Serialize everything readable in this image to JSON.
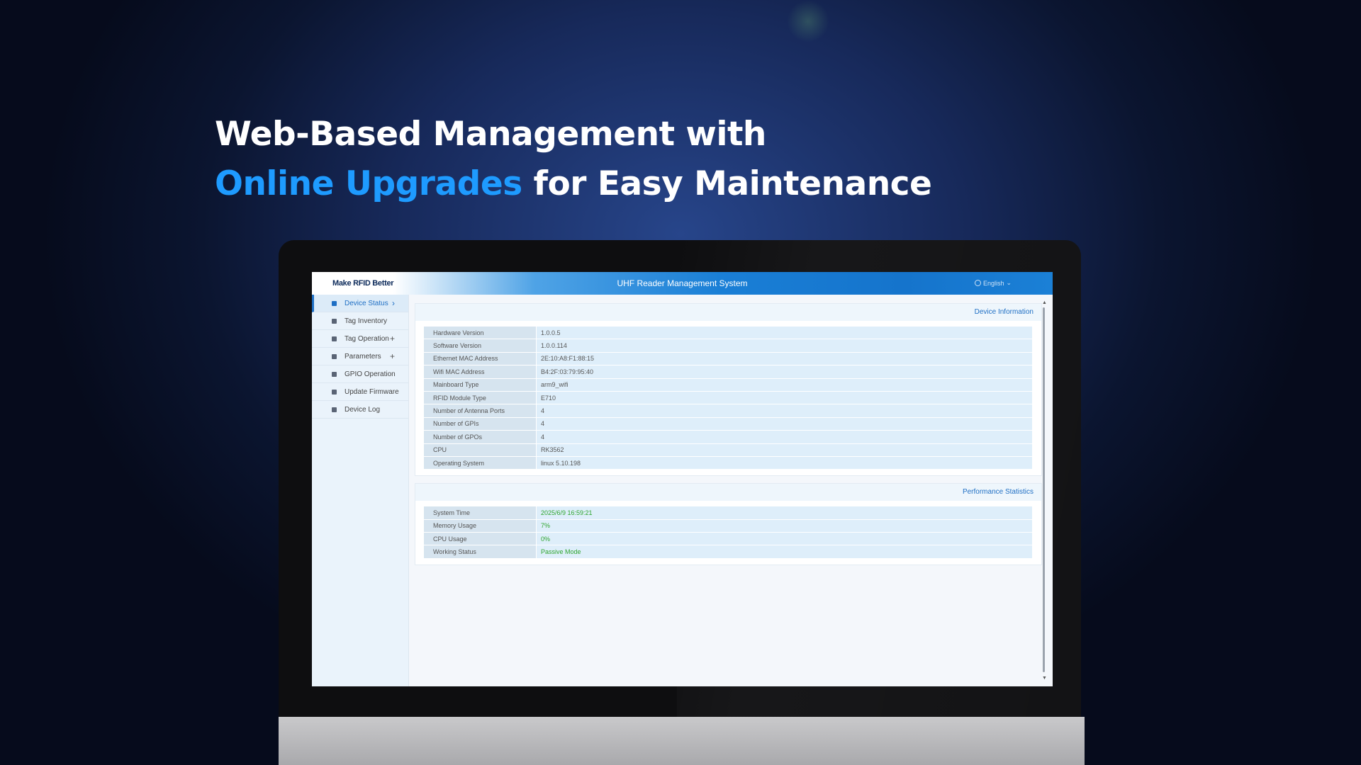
{
  "headline": {
    "line1": "Web-Based Management with",
    "line2_accent": "Online Upgrades",
    "line2_rest": " for Easy Maintenance",
    "accent_color": "#1e9bff"
  },
  "app": {
    "logo": "Make RFID Better",
    "title": "UHF Reader Management System",
    "language": "English",
    "language_icon": "globe-icon"
  },
  "sidebar": {
    "items": [
      {
        "label": "Device Status",
        "icon": "device-status-icon",
        "trail": "›",
        "active": true
      },
      {
        "label": "Tag Inventory",
        "icon": "inventory-icon",
        "trail": "",
        "active": false
      },
      {
        "label": "Tag Operation",
        "icon": "tag-operation-icon",
        "trail": "+",
        "active": false
      },
      {
        "label": "Parameters",
        "icon": "gear-icon",
        "trail": "+",
        "active": false
      },
      {
        "label": "GPIO Operation",
        "icon": "gpio-icon",
        "trail": "",
        "active": false
      },
      {
        "label": "Update Firmware",
        "icon": "firmware-icon",
        "trail": "",
        "active": false
      },
      {
        "label": "Device Log",
        "icon": "log-icon",
        "trail": "",
        "active": false
      }
    ]
  },
  "device_info": {
    "title": "Device Information",
    "rows": [
      {
        "key": "Hardware Version",
        "value": "1.0.0.5"
      },
      {
        "key": "Software Version",
        "value": "1.0.0.114"
      },
      {
        "key": "Ethernet MAC Address",
        "value": "2E:10:A8:F1:88:15"
      },
      {
        "key": "Wifi MAC Address",
        "value": "B4:2F:03:79:95:40"
      },
      {
        "key": "Mainboard Type",
        "value": "arm9_wifi"
      },
      {
        "key": "RFID Module Type",
        "value": "E710"
      },
      {
        "key": "Number of Antenna Ports",
        "value": "4"
      },
      {
        "key": "Number of GPIs",
        "value": "4"
      },
      {
        "key": "Number of GPOs",
        "value": "4"
      },
      {
        "key": "CPU",
        "value": "RK3562"
      },
      {
        "key": "Operating System",
        "value": "linux 5.10.198"
      }
    ]
  },
  "performance": {
    "title": "Performance Statistics",
    "rows": [
      {
        "key": "System Time",
        "value": "2025/6/9 16:59:21"
      },
      {
        "key": "Memory Usage",
        "value": "7%"
      },
      {
        "key": "CPU Usage",
        "value": "0%"
      },
      {
        "key": "Working Status",
        "value": "Passive Mode"
      }
    ],
    "value_color": "#2fa52f"
  }
}
